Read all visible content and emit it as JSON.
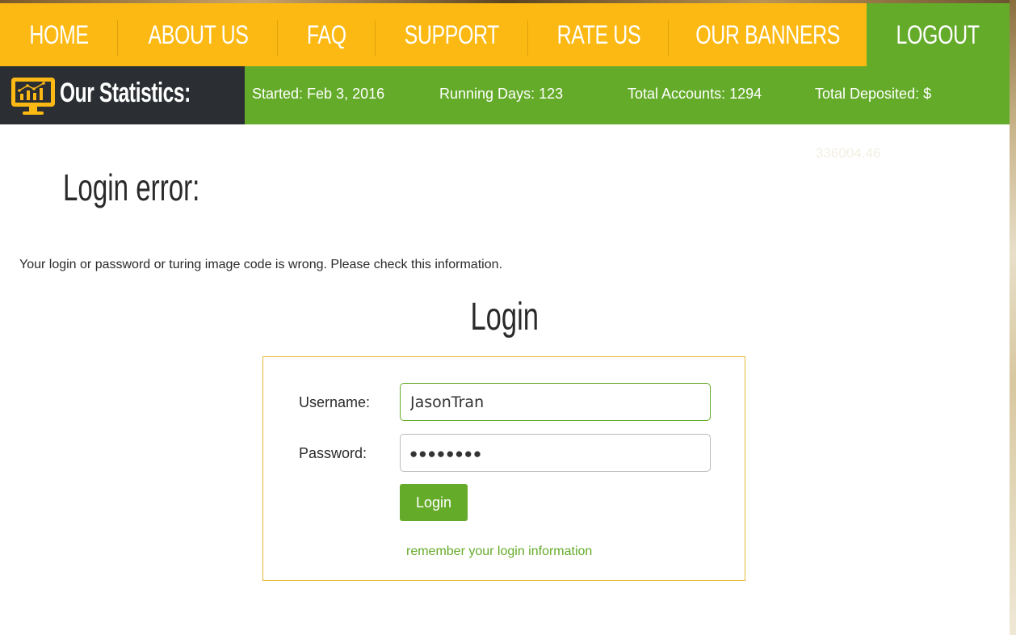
{
  "nav": {
    "items": [
      {
        "label": "HOME"
      },
      {
        "label": "ABOUT US"
      },
      {
        "label": "FAQ"
      },
      {
        "label": "SUPPORT"
      },
      {
        "label": "RATE US"
      },
      {
        "label": "OUR BANNERS"
      },
      {
        "label": "LOGOUT"
      }
    ],
    "colors": {
      "bar": "#fdb913",
      "logout": "#65ab2a"
    }
  },
  "stats": {
    "title": "Our Statistics:",
    "icon": "monitor-chart-icon",
    "started": "Started: Feb 3, 2016",
    "running_days": "Running Days: 123",
    "total_accounts": "Total Accounts: 1294",
    "total_deposited": "Total Deposited: $",
    "total_deposited_value": "336004.46",
    "colors": {
      "bar": "#65ab2a",
      "head": "#2b2f33",
      "accent": "#fdb913"
    }
  },
  "error": {
    "title": "Login error:",
    "message": "Your login or password or turing image code is wrong. Please check this information."
  },
  "login": {
    "title": "Login",
    "username_label": "Username:",
    "username_value": "JasonTran",
    "password_label": "Password:",
    "password_mask": "●●●●●●●●",
    "button_label": "Login",
    "remember_link": "remember your login information"
  }
}
